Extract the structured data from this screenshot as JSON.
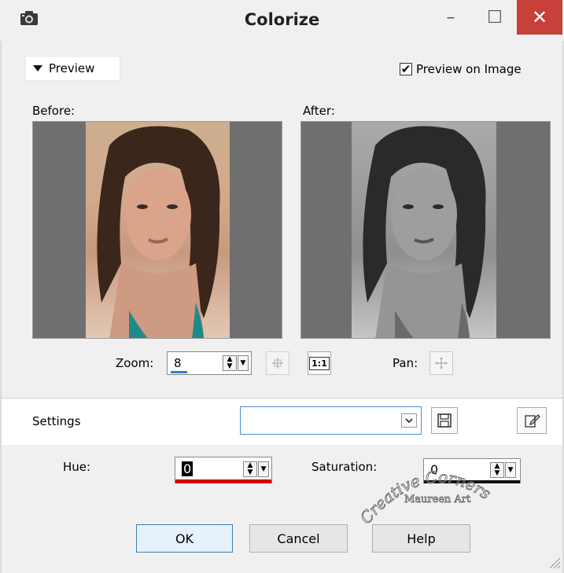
{
  "window": {
    "title": "Colorize",
    "app_icon": "camera-icon",
    "minimize_glyph": "–",
    "maximize_glyph": "☐",
    "close_glyph": "✕"
  },
  "preview": {
    "toggle_label": "Preview",
    "toggle_icon": "caret-down-icon",
    "preview_on_image_label": "Preview on Image",
    "preview_on_image_checked": true
  },
  "before": {
    "label": "Before:"
  },
  "after": {
    "label": "After:"
  },
  "zoom": {
    "label": "Zoom:",
    "value": "8",
    "level": 0.08
  },
  "pan": {
    "label": "Pan:"
  },
  "actual_size_label": "1:1",
  "settings": {
    "label": "Settings",
    "value": ""
  },
  "hue": {
    "label": "Hue:",
    "value": "0",
    "accent_color": "#d00000"
  },
  "saturation": {
    "label": "Saturation:",
    "value": "0"
  },
  "watermark": {
    "line1": "Creative Corners",
    "line2": "Maureen Art"
  },
  "buttons": {
    "ok": "OK",
    "cancel": "Cancel",
    "help": "Help"
  }
}
